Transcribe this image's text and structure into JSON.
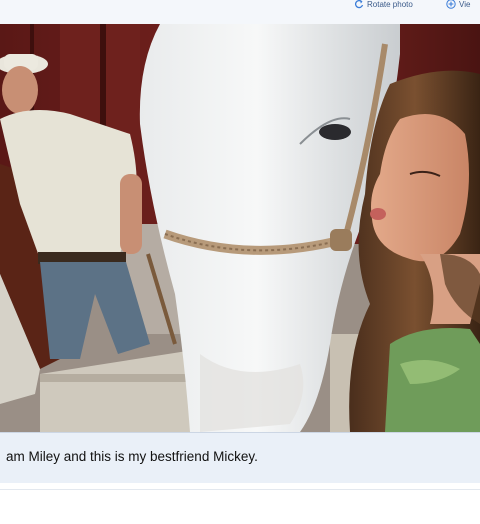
{
  "toolbar": {
    "rotate_label": "Rotate photo",
    "view_label": "Vie"
  },
  "photo": {
    "icon": "photo-image"
  },
  "caption": {
    "text": "am Miley and this is my bestfriend Mickey."
  },
  "colors": {
    "toolbar_bg": "#f4f7fb",
    "caption_bg": "#eaf0f8",
    "link": "#3b5b8a"
  }
}
